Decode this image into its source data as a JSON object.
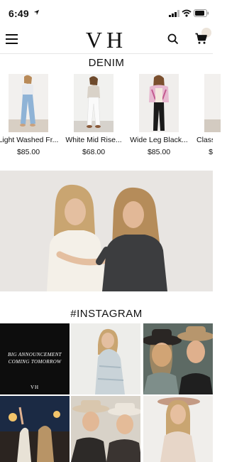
{
  "status_bar": {
    "time": "6:49"
  },
  "header": {
    "logo": "VH"
  },
  "collection": {
    "title": "DENIM",
    "products": [
      {
        "name": "Light Washed Fr...",
        "price": "$85.00"
      },
      {
        "name": "White Mid Rise...",
        "price": "$68.00"
      },
      {
        "name": "Wide Leg Black...",
        "price": "$85.00"
      },
      {
        "name": "Class",
        "price": "$"
      }
    ]
  },
  "instagram": {
    "title": "#INSTAGRAM",
    "announcement_line1": "BIG ANNOUNCEMENT",
    "announcement_line2": "COMING TOMORROW",
    "announcement_mark": "VH"
  },
  "colors": {
    "accent": "#111111",
    "hero_bg": "#e9e6e3",
    "cart_badge": "#ece4da"
  }
}
